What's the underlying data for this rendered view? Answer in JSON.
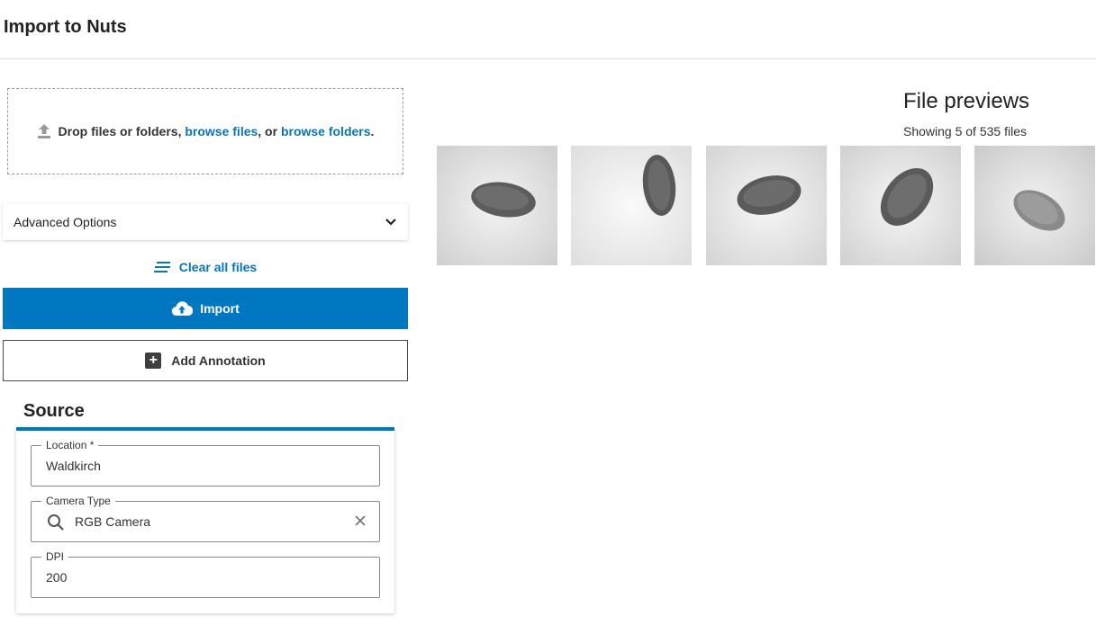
{
  "header": {
    "title": "Import to Nuts"
  },
  "dropzone": {
    "text_before": "Drop files or folders,",
    "browse_files": "browse files",
    "text_middle": ", or",
    "browse_folders": "browse folders",
    "text_after": "."
  },
  "advanced": {
    "label": "Advanced Options"
  },
  "actions": {
    "clear_label": "Clear all files",
    "import_label": "Import",
    "annotation_label": "Add Annotation"
  },
  "source": {
    "title": "Source",
    "location": {
      "label": "Location *",
      "value": "Waldkirch"
    },
    "camera_type": {
      "label": "Camera Type",
      "value": "RGB Camera"
    },
    "dpi": {
      "label": "DPI",
      "value": "200"
    }
  },
  "previews": {
    "title": "File previews",
    "count_text": "Showing 5 of 535 files",
    "thumbnails": [
      "almond",
      "almond",
      "almond",
      "almond",
      "peanut"
    ]
  },
  "colors": {
    "accent": "#0078c1",
    "link": "#0a74b5"
  }
}
